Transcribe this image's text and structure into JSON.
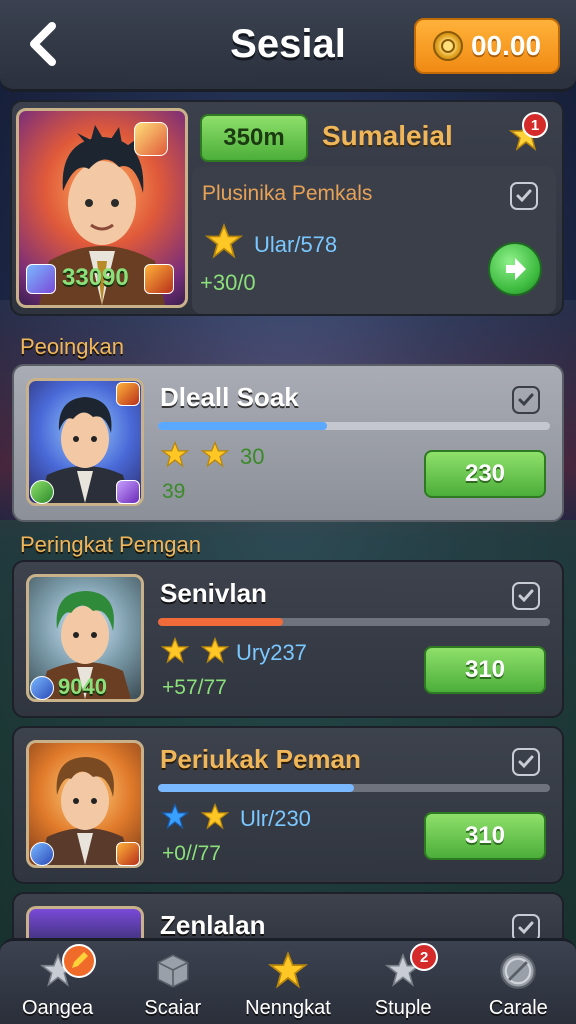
{
  "header": {
    "title": "Sesial",
    "coins": "00.00"
  },
  "featured": {
    "level_pill": "350m",
    "name": "Sumaleial",
    "badge_count": "1",
    "subtitle": "Plusinika Pemkals",
    "rating": "33090",
    "stat_value": "Ular/578",
    "stat_change": "+30/0"
  },
  "sections": {
    "first": "Peoingkan",
    "second": "Peringkat Pemgan"
  },
  "players": [
    {
      "name": "Dleall Soak",
      "stat_a": "30",
      "stat_b": "39",
      "price": "230",
      "progress": 0.43
    },
    {
      "name": "Senivlan",
      "stat_a": "Ury237",
      "stat_b": "+57/77",
      "rating": "9040",
      "price": "310",
      "progress": 0.32
    },
    {
      "name": "Periukak Peman",
      "stat_a": "Ulr/230",
      "stat_b": "+0//77",
      "price": "310",
      "progress": 0.5
    },
    {
      "name": "Zenlalan"
    }
  ],
  "nav": {
    "items": [
      {
        "label": "Oangea",
        "icon": "star-icon"
      },
      {
        "label": "Scaiar",
        "icon": "cube-icon"
      },
      {
        "label": "Nenngkat",
        "icon": "gold-star-icon"
      },
      {
        "label": "Stuple",
        "icon": "star-icon",
        "badge": "2"
      },
      {
        "label": "Carale",
        "icon": "ball-icon"
      }
    ]
  },
  "colors": {
    "accent_orange": "#f08a14",
    "green": "#4cae3a",
    "gold": "#f0b65a"
  }
}
